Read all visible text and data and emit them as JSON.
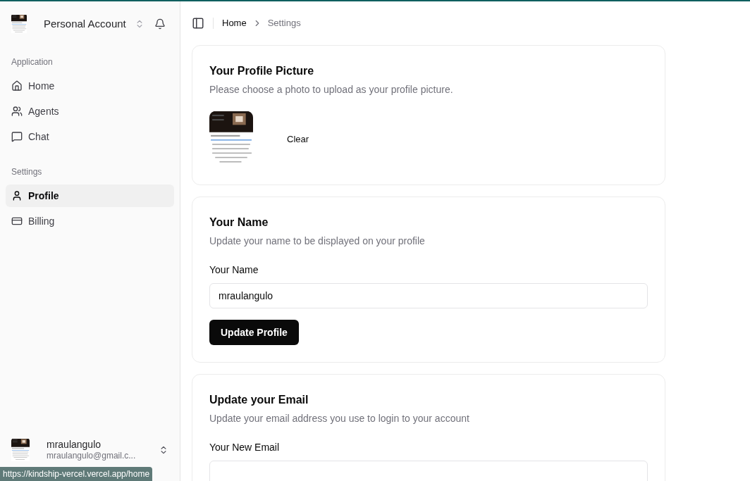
{
  "account_switcher": {
    "label": "Personal Account"
  },
  "sidebar": {
    "groups": [
      {
        "title": "Application",
        "items": [
          {
            "label": "Home",
            "selected": false
          },
          {
            "label": "Agents",
            "selected": false
          },
          {
            "label": "Chat",
            "selected": false
          }
        ]
      },
      {
        "title": "Settings",
        "items": [
          {
            "label": "Profile",
            "selected": true
          },
          {
            "label": "Billing",
            "selected": false
          }
        ]
      }
    ]
  },
  "user": {
    "name": "mraulangulo",
    "email": "mraulangulo@gmail.c..."
  },
  "status_url": "https://kindship-vercel.vercel.app/home",
  "breadcrumb": [
    {
      "label": "Home",
      "current": false
    },
    {
      "label": "Settings",
      "current": true
    }
  ],
  "cards": [
    {
      "kind": "picture",
      "title": "Your Profile Picture",
      "description": "Please choose a photo to upload as your profile picture.",
      "button": "Clear"
    },
    {
      "kind": "form",
      "title": "Your Name",
      "description": "Update your name to be displayed on your profile",
      "field_label": "Your Name",
      "value": "mraulangulo",
      "button": "Update Profile"
    },
    {
      "kind": "form",
      "title": "Update your Email",
      "description": "Update your email address you use to login to your account",
      "field_label": "Your New Email"
    }
  ]
}
